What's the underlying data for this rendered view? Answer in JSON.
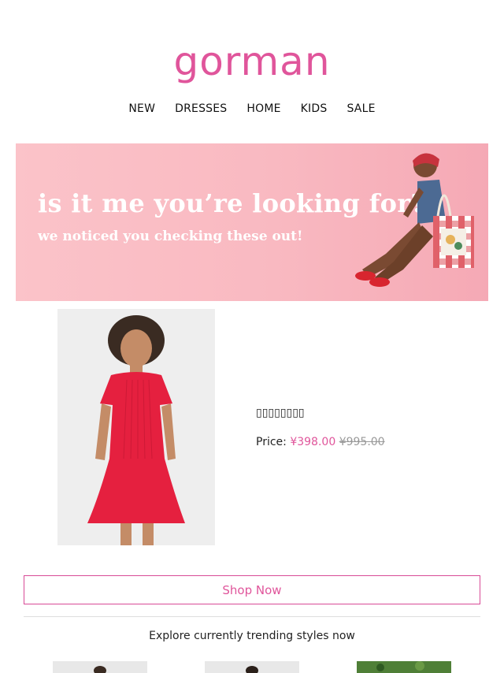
{
  "brand": {
    "logo_text": "gorman"
  },
  "nav": {
    "items": [
      "NEW",
      "DRESSES",
      "HOME",
      "KIDS",
      "SALE"
    ]
  },
  "hero": {
    "title": "is it me you’re looking for?",
    "subtitle": "we noticed you checking these out!"
  },
  "product": {
    "name": "▯▯▯▯▯▯▯▯",
    "price_label": "Price:",
    "sale_price": "¥398.00",
    "original_price": "¥995.00",
    "dress_color": "#e5203f"
  },
  "cta": {
    "shop_now": "Shop Now"
  },
  "trending": {
    "heading": "Explore currently trending styles now"
  },
  "colors": {
    "accent": "#e0559b",
    "hero_bg": "#f9b9c1"
  }
}
